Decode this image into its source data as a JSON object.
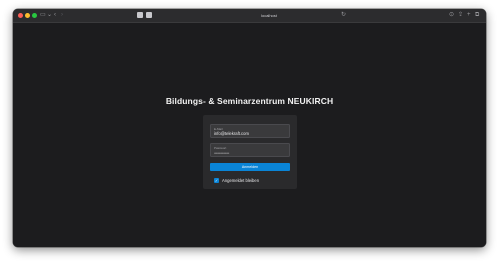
{
  "browser": {
    "address": "localhost",
    "colors": {
      "toolbar": "#2c2c2e",
      "background": "#1c1c1e"
    }
  },
  "page": {
    "title": "Bildungs- & Seminarzentrum NEUKIRCH"
  },
  "login": {
    "email_label": "E-Mail",
    "email_value": "info@telekraft.com",
    "password_label": "Passwort",
    "password_value": "••••••••••••••••••••",
    "submit_label": "Anmelden",
    "remember_label": "Angemeldet bleiben",
    "remember_checked": true,
    "accent_color": "#0a84d6"
  }
}
